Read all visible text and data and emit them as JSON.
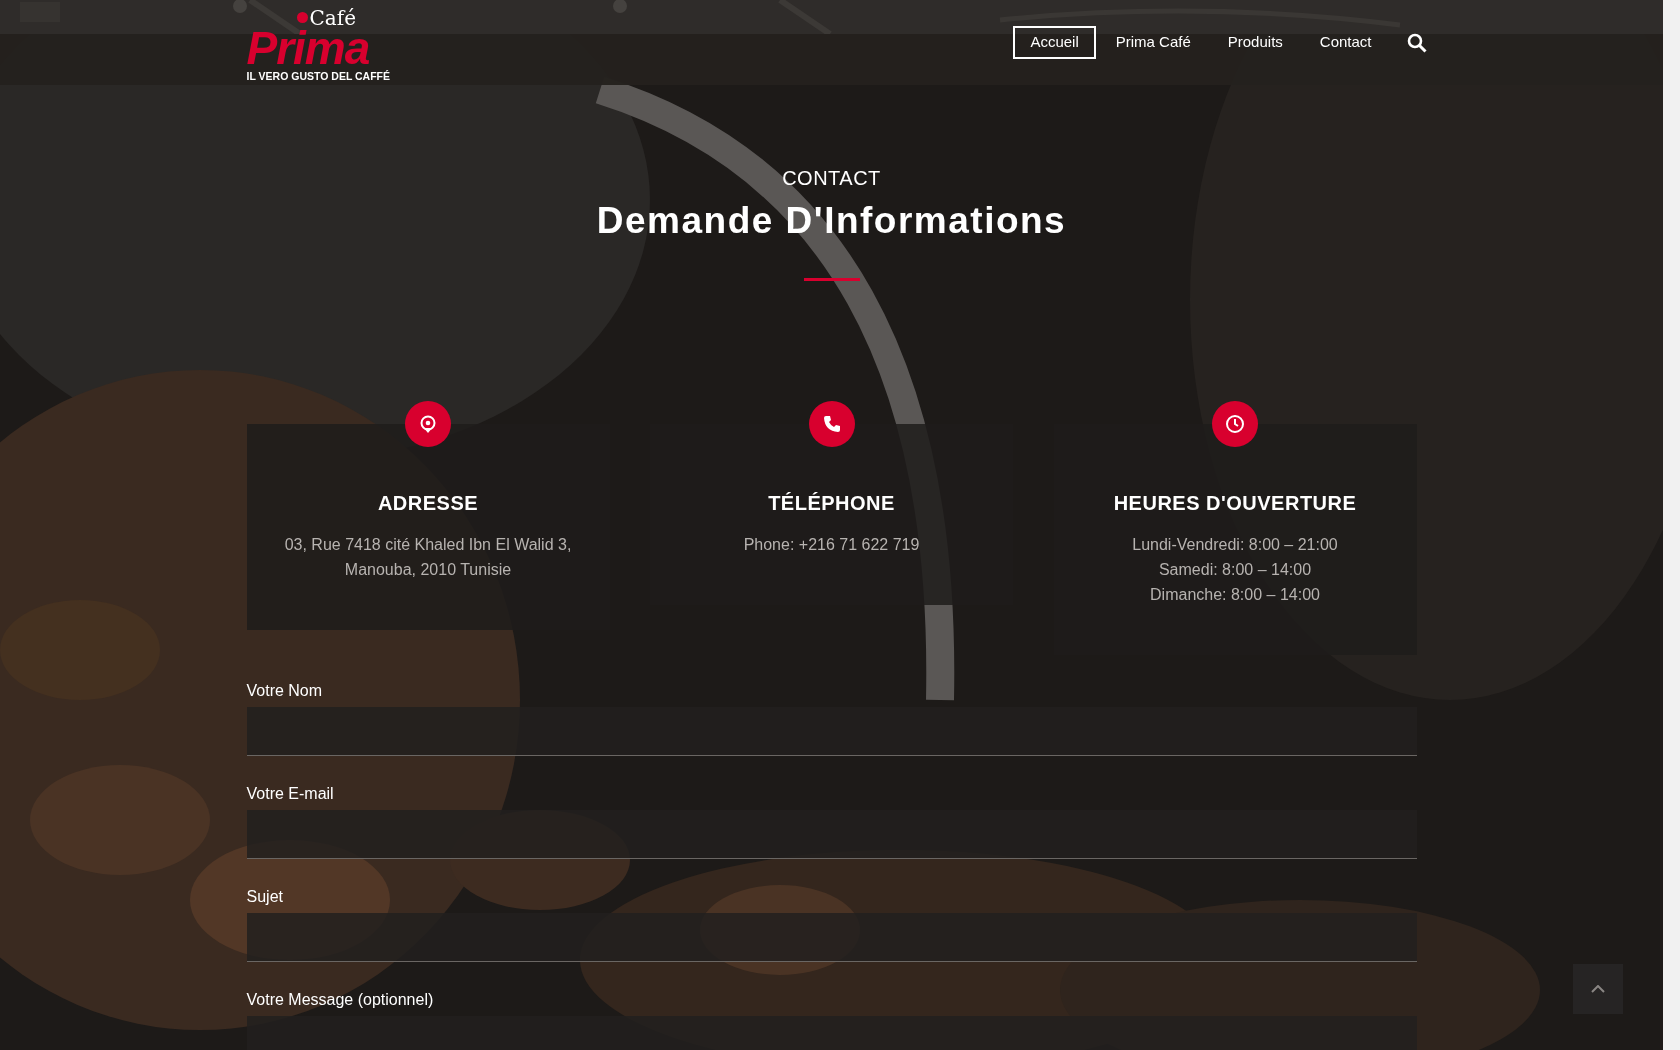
{
  "logo": {
    "top": "Café",
    "main": "Prima",
    "tagline": "IL VERO GUSTO DEL CAFFÉ"
  },
  "nav": [
    {
      "label": "Accueil",
      "selected": true
    },
    {
      "label": "Prima Café",
      "selected": false
    },
    {
      "label": "Produits",
      "selected": false
    },
    {
      "label": "Contact",
      "selected": false
    }
  ],
  "section": {
    "kicker": "CONTACT",
    "title": "Demande D'Informations"
  },
  "cards": [
    {
      "kind": "location",
      "title": "ADRESSE",
      "lines": [
        "03, Rue 7418 cité Khaled Ibn El Walid 3, Manouba, 2010 Tunisie"
      ]
    },
    {
      "kind": "phone",
      "title": "TÉLÉPHONE",
      "lines": [
        "Phone: +216 71 622 719"
      ]
    },
    {
      "kind": "clock",
      "title": "HEURES D'OUVERTURE",
      "lines": [
        "Lundi-Vendredi: 8:00 – 21:00",
        "Samedi: 8:00 – 14:00",
        "Dimanche: 8:00 – 14:00"
      ]
    }
  ],
  "form": [
    {
      "label": "Votre Nom",
      "kind": "input"
    },
    {
      "label": "Votre E-mail",
      "kind": "input"
    },
    {
      "label": "Sujet",
      "kind": "input"
    },
    {
      "label": "Votre Message (optionnel)",
      "kind": "textarea"
    }
  ]
}
